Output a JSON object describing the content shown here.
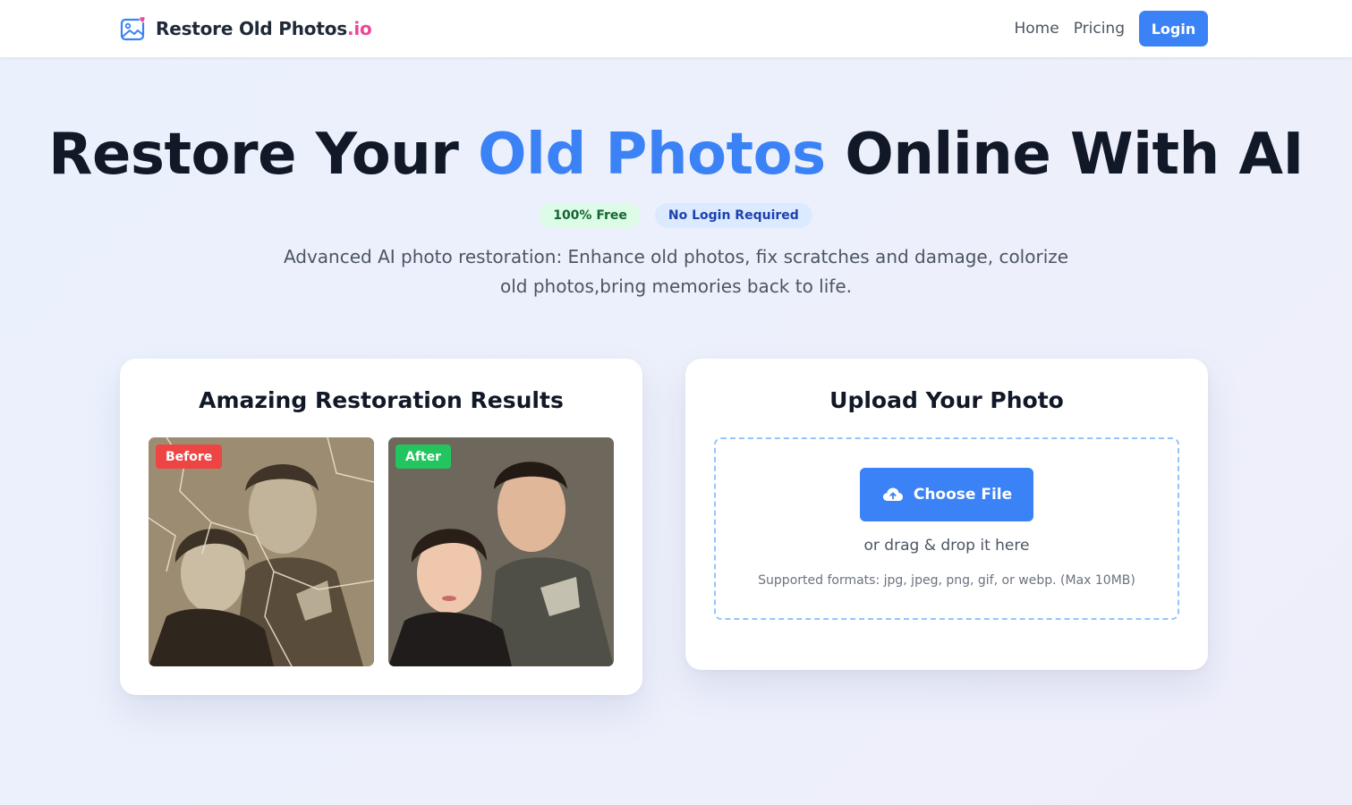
{
  "header": {
    "brand_main": "Restore Old Photos",
    "brand_suffix": ".io",
    "logo_icon": "photo-heart-icon",
    "nav": [
      {
        "label": "Home"
      },
      {
        "label": "Pricing"
      }
    ],
    "login_label": "Login"
  },
  "hero": {
    "title_part1": "Restore Your ",
    "title_highlight": "Old Photos",
    "title_part2": " Online With AI",
    "badges": [
      {
        "label": "100% Free"
      },
      {
        "label": "No Login Required"
      }
    ],
    "subtitle": "Advanced AI photo restoration: Enhance old photos, fix scratches and damage, colorize old photos,bring memories back to life."
  },
  "results_card": {
    "title": "Amazing Restoration Results",
    "before_label": "Before",
    "after_label": "After"
  },
  "upload_card": {
    "title": "Upload Your Photo",
    "button_label": "Choose File",
    "button_icon": "cloud-upload-icon",
    "drag_text": "or drag & drop it here",
    "formats_text": "Supported formats: jpg, jpeg, png, gif, or webp. (Max 10MB)"
  },
  "colors": {
    "accent_blue": "#3b82f6",
    "brand_pink": "#ec4899",
    "before_red": "#ef4444",
    "after_green": "#22c55e"
  }
}
